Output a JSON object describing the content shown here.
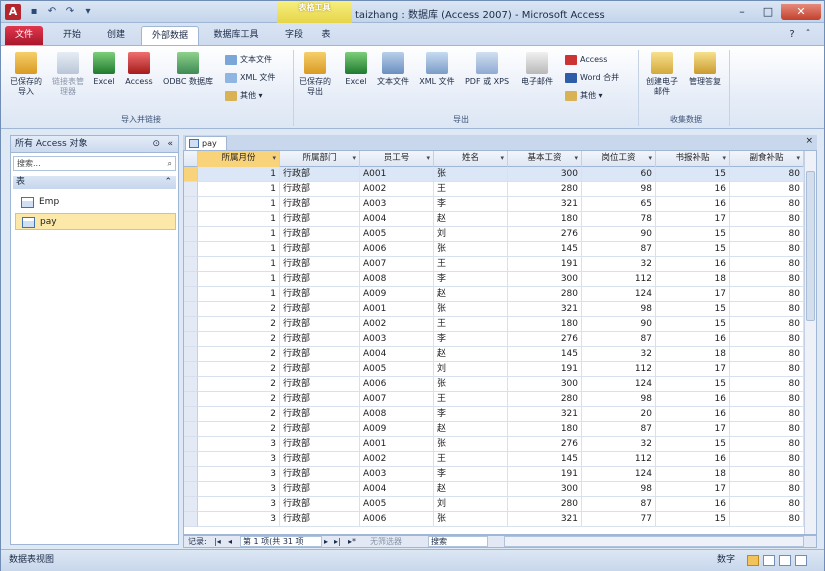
{
  "titlebar": {
    "quick_access": [
      "save-icon",
      "undo-icon",
      "redo-icon",
      "customize-icon"
    ],
    "context_group": "表格工具",
    "window_title": "taizhang : 数据库 (Access 2007) - Microsoft Access",
    "min": "–",
    "max": "□",
    "close": "✕"
  },
  "tabs": [
    {
      "label": "文件"
    },
    {
      "label": "开始"
    },
    {
      "label": "创建"
    },
    {
      "label": "外部数据"
    },
    {
      "label": "数据库工具"
    },
    {
      "label": "字段"
    },
    {
      "label": "表"
    }
  ],
  "ribbon": {
    "import": {
      "saved": "已保存的导入",
      "linked": "链接表管理器",
      "excel": "Excel",
      "access": "Access",
      "odbc": "ODBC 数据库",
      "text": "文本文件",
      "xml": "XML 文件",
      "more": "其他 ▾",
      "group": "导入并链接"
    },
    "export": {
      "saved": "已保存的导出",
      "excel": "Excel",
      "text": "文本文件",
      "xml": "XML 文件",
      "pdf": "PDF 或 XPS",
      "email": "电子邮件",
      "access": "Access",
      "word": "Word 合并",
      "more": "其他 ▾",
      "group": "导出"
    },
    "collect": {
      "create": "创建电子邮件",
      "manage": "管理答复",
      "group": "收集数据"
    }
  },
  "nav": {
    "header": "所有 Access 对象",
    "search_placeholder": "搜索...",
    "group": "表",
    "items": [
      {
        "label": "Emp"
      },
      {
        "label": "pay"
      }
    ]
  },
  "doc_tab": "pay",
  "columns": [
    "所属月份",
    "所属部门",
    "员工号",
    "姓名",
    "基本工资",
    "岗位工资",
    "书报补贴",
    "副食补贴"
  ],
  "rows": [
    [
      "1",
      "行政部",
      "A001",
      "张",
      "300",
      "60",
      "15",
      "80"
    ],
    [
      "1",
      "行政部",
      "A002",
      "王",
      "280",
      "98",
      "16",
      "80"
    ],
    [
      "1",
      "行政部",
      "A003",
      "李",
      "321",
      "65",
      "16",
      "80"
    ],
    [
      "1",
      "行政部",
      "A004",
      "赵",
      "180",
      "78",
      "17",
      "80"
    ],
    [
      "1",
      "行政部",
      "A005",
      "刘",
      "276",
      "90",
      "15",
      "80"
    ],
    [
      "1",
      "行政部",
      "A006",
      "张",
      "145",
      "87",
      "15",
      "80"
    ],
    [
      "1",
      "行政部",
      "A007",
      "王",
      "191",
      "32",
      "16",
      "80"
    ],
    [
      "1",
      "行政部",
      "A008",
      "李",
      "300",
      "112",
      "18",
      "80"
    ],
    [
      "1",
      "行政部",
      "A009",
      "赵",
      "280",
      "124",
      "17",
      "80"
    ],
    [
      "2",
      "行政部",
      "A001",
      "张",
      "321",
      "98",
      "15",
      "80"
    ],
    [
      "2",
      "行政部",
      "A002",
      "王",
      "180",
      "90",
      "15",
      "80"
    ],
    [
      "2",
      "行政部",
      "A003",
      "李",
      "276",
      "87",
      "16",
      "80"
    ],
    [
      "2",
      "行政部",
      "A004",
      "赵",
      "145",
      "32",
      "18",
      "80"
    ],
    [
      "2",
      "行政部",
      "A005",
      "刘",
      "191",
      "112",
      "17",
      "80"
    ],
    [
      "2",
      "行政部",
      "A006",
      "张",
      "300",
      "124",
      "15",
      "80"
    ],
    [
      "2",
      "行政部",
      "A007",
      "王",
      "280",
      "98",
      "16",
      "80"
    ],
    [
      "2",
      "行政部",
      "A008",
      "李",
      "321",
      "20",
      "16",
      "80"
    ],
    [
      "2",
      "行政部",
      "A009",
      "赵",
      "180",
      "87",
      "17",
      "80"
    ],
    [
      "3",
      "行政部",
      "A001",
      "张",
      "276",
      "32",
      "15",
      "80"
    ],
    [
      "3",
      "行政部",
      "A002",
      "王",
      "145",
      "112",
      "16",
      "80"
    ],
    [
      "3",
      "行政部",
      "A003",
      "李",
      "191",
      "124",
      "18",
      "80"
    ],
    [
      "3",
      "行政部",
      "A004",
      "赵",
      "300",
      "98",
      "17",
      "80"
    ],
    [
      "3",
      "行政部",
      "A005",
      "刘",
      "280",
      "87",
      "16",
      "80"
    ],
    [
      "3",
      "行政部",
      "A006",
      "张",
      "321",
      "77",
      "15",
      "80"
    ]
  ],
  "record_nav": {
    "label": "记录:",
    "position": "第 1 项(共 31 项",
    "filter": "无筛选器",
    "search": "搜索"
  },
  "status": {
    "left": "数据表视图",
    "right": "数字"
  }
}
